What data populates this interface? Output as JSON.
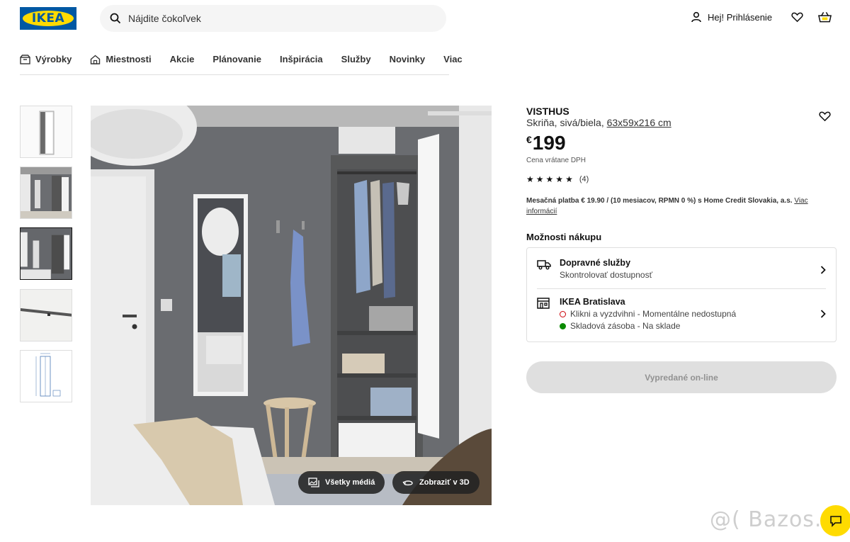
{
  "header": {
    "logo_text": "IKEA",
    "search_placeholder": "Nájdite čokoľvek",
    "login_label": "Hej! Prihlásenie"
  },
  "nav": {
    "items": [
      {
        "label": "Výrobky",
        "icon": "box-icon"
      },
      {
        "label": "Miestnosti",
        "icon": "house-icon"
      },
      {
        "label": "Akcie"
      },
      {
        "label": "Plánovanie"
      },
      {
        "label": "Inšpirácia"
      },
      {
        "label": "Služby"
      },
      {
        "label": "Novinky"
      },
      {
        "label": "Viac"
      }
    ]
  },
  "gallery": {
    "all_media_label": "Všetky médiá",
    "view_3d_label": "Zobraziť v 3D",
    "active_thumb": 3
  },
  "product": {
    "name": "VISTHUS",
    "description": "Skriňa, sivá/biela,",
    "dimensions": "63x59x216 cm",
    "currency": "€",
    "price": "199",
    "vat_note": "Cena vrátane DPH",
    "rating_stars": 5,
    "review_count": "(4)",
    "monthly_payment": "Mesačná platba € 19.90 / (10 mesiacov, RPMN 0 %) s Home Credit Slovakia, a.s.",
    "monthly_link": "Viac informácií"
  },
  "purchase": {
    "title": "Možnosti nákupu",
    "delivery_title": "Dopravné služby",
    "delivery_sub": "Skontrolovať dostupnosť",
    "store_title": "IKEA Bratislava",
    "click_collect": "Klikni a vyzdvihni - Momentálne nedostupná",
    "store_stock": "Skladová zásoba - Na sklade",
    "soldout_label": "Vypredané on-line"
  },
  "colors": {
    "brand_blue": "#0058a3",
    "brand_yellow": "#ffdb00",
    "unavailable_red": "#cc0008",
    "in_stock_green": "#0a8a00"
  },
  "watermark": "@( Bazos.sk"
}
